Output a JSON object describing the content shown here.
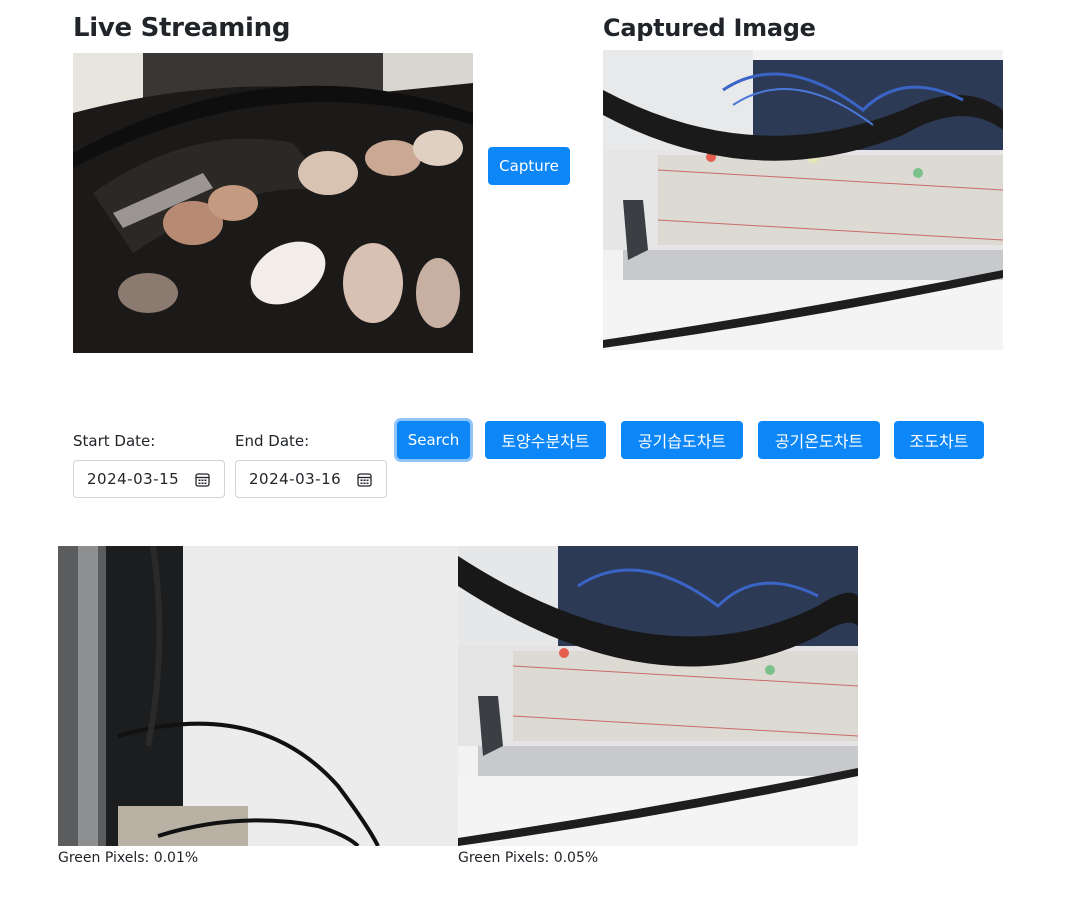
{
  "live": {
    "title": "Live Streaming"
  },
  "captured": {
    "title": "Captured Image"
  },
  "capture_button": "Capture",
  "filters": {
    "start_label": "Start Date:",
    "start_value": "2024-03-15",
    "end_label": "End Date:",
    "end_value": "2024-03-16",
    "search_button": "Search"
  },
  "chart_buttons": [
    "토양수분차트",
    "공기습도차트",
    "공기온도차트",
    "조도차트"
  ],
  "results": [
    {
      "caption": "Green Pixels: 0.01%"
    },
    {
      "caption": "Green Pixels: 0.05%"
    }
  ],
  "colors": {
    "primary": "#0d86f7",
    "focus_ring": "#8fc3fb"
  },
  "icons": {
    "date_picker": "calendar-icon"
  }
}
